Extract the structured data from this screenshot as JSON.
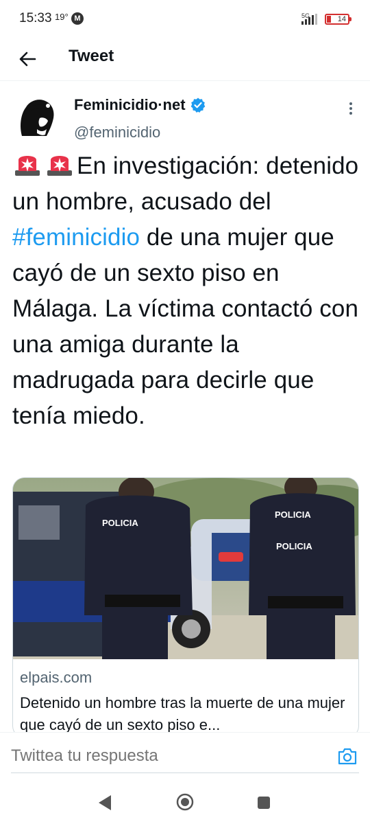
{
  "status": {
    "time": "15:33",
    "temp": "19°",
    "m_badge": "M",
    "network": "5G",
    "battery": "14"
  },
  "header": {
    "title": "Tweet"
  },
  "tweet": {
    "author_name": "Feminicidio·net",
    "handle": "@feminicidio",
    "text_before_hashtag": "En investigación: detenido un hombre, acusado del ",
    "hashtag": "#feminicidio",
    "text_after_hashtag": " de una mujer que cayó de un sexto piso en Málaga. La víctima contactó con una amiga durante la madrugada para decirle que tenía miedo.",
    "card": {
      "image_labels": [
        "POLICIA",
        "POLICIA",
        "POLICIA"
      ],
      "domain": "elpais.com",
      "title": "Detenido un hombre tras la muerte de una mujer que cayó de un sexto piso e..."
    }
  },
  "reply": {
    "placeholder": "Twittea tu respuesta"
  },
  "colors": {
    "accent": "#1d9bf0",
    "text": "#0f1419",
    "secondary": "#536471"
  },
  "icons": {
    "back": "arrow-left-icon",
    "verified": "verified-badge-icon",
    "more": "more-vertical-icon",
    "siren": "police-siren-icon",
    "camera": "camera-icon",
    "nav_back": "triangle-back-icon",
    "nav_home": "circle-home-icon",
    "nav_recent": "square-recent-icon"
  }
}
